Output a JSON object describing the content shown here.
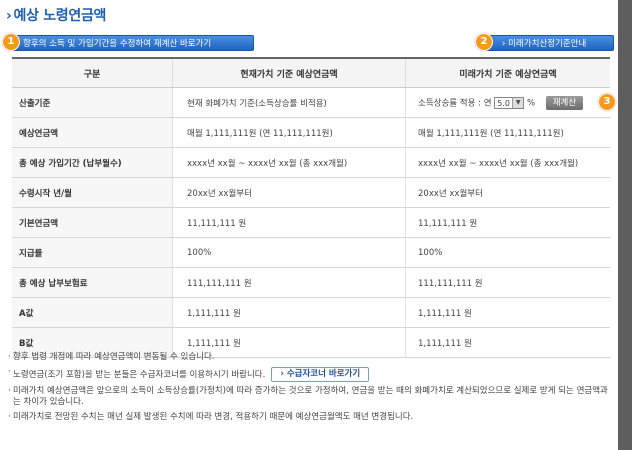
{
  "page": {
    "title": "예상 노령연금액"
  },
  "buttons": {
    "recalc": "향후의 소득 및 가입기간을 수정하여 재계산 바로가기",
    "future_guide": "미래가치산정기준안내",
    "recalc_small": "재계산",
    "pension_corner": "수급자코너 바로가기"
  },
  "badges": {
    "one": "1",
    "two": "2",
    "three": "3"
  },
  "table": {
    "headers": [
      "구분",
      "현재가치 기준 예상연금액",
      "미래가치 기준 예상연금액"
    ],
    "rows": [
      {
        "label": "산출기준",
        "current": "현재 화폐가치 기준(소득상승률 비적용)",
        "future_prefix": "소득상승률 적용 : 연",
        "future_select": "5.0",
        "future_suffix": "%"
      },
      {
        "label": "예상연금액",
        "current": "매월 1,111,111원 (연 11,111,111원)",
        "future": "매월 1,111,111원 (연 11,111,111원)"
      },
      {
        "label": "총 예상 가입기간 (납부월수)",
        "current": "xxxx년 xx월 ~ xxxx년 xx월 (총 xxx개월)",
        "future": "xxxx년 xx월 ~ xxxx년 xx월 (총 xxx개월)"
      },
      {
        "label": "수령시작 년/월",
        "current": "20xx년 xx월부터",
        "future": "20xx년 xx월부터"
      },
      {
        "label": "기본연금액",
        "current": "11,111,111 원",
        "future": "11,111,111 원"
      },
      {
        "label": "지급률",
        "current": "100%",
        "future": "100%"
      },
      {
        "label": "총 예상 납부보험료",
        "current": "111,111,111 원",
        "future": "111,111,111 원"
      },
      {
        "label": "A값",
        "current": "1,111,111 원",
        "future": "1,111,111 원"
      },
      {
        "label": "B값",
        "current": "1,111,111 원",
        "future": "1,111,111 원"
      }
    ]
  },
  "notes": [
    "향후 법령 개정에 따라 예상연금액이 변동될 수 있습니다.",
    "노령연금(조기 포함)을 받는 분들은 수급자코너를 이용하시기 바랍니다.",
    "미래가치 예상연금액은 앞으로의 소득이 소득상승률(가정치)에 따라 증가하는 것으로 가정하여, 연금을 받는 때의 화폐가치로 계산되었으므로 실제로 받게 되는 연금액과는 차이가 있습니다.",
    "미래가치로 전망된 수치는 매년 실제 발생된 수치에 따라 변경, 적용하기 때문에 예상연금월액도 매년 변경됩니다."
  ]
}
